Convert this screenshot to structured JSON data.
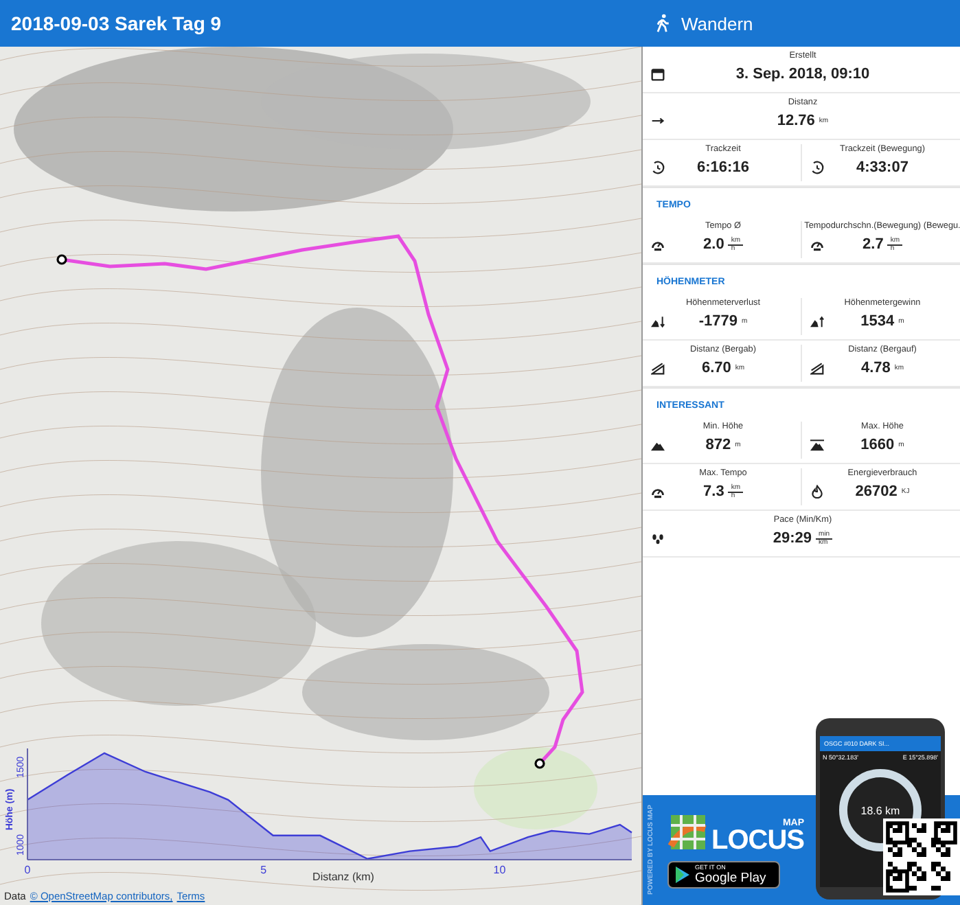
{
  "window": {
    "title": "2018-09-03 Sarek Tag 9"
  },
  "map": {
    "attribution": {
      "text": "Data",
      "links": [
        "© OpenStreetMap contributors,",
        "Terms"
      ]
    },
    "elevation_profile": {
      "chart_data": {
        "type": "area",
        "xlabel": "Distanz (km)",
        "ylabel": "Höhe (m)",
        "x": [
          0,
          0.85,
          1.63,
          2.5,
          3.86,
          4.25,
          5.2,
          6.2,
          7.2,
          8.1,
          9.1,
          9.6,
          9.8,
          10.6,
          11.1,
          11.9,
          12.55,
          12.8
        ],
        "series": [
          {
            "color": "#3d3dd6",
            "values": [
              1290,
              1450,
              1590,
              1470,
              1340,
              1290,
              1060,
              1060,
              910,
              960,
              990,
              1050,
              960,
              1050,
              1090,
              1070,
              1130,
              1080
            ]
          }
        ],
        "xlim": [
          0,
          12.8
        ],
        "ylim": [
          905,
          1620
        ],
        "xticks": [
          0,
          5,
          10
        ],
        "yticks": [
          1000,
          1500
        ]
      }
    }
  },
  "panel": {
    "title": "Wandern",
    "sections": [
      {
        "rows": [
          {
            "cells": [
              {
                "label": "Erstellt",
                "value": "3. Sep. 2018, 09:10"
              }
            ]
          },
          {
            "cells": [
              {
                "label": "Distanz",
                "value": "12.76",
                "unit": "km"
              }
            ]
          },
          {
            "cells": [
              {
                "label": "Trackzeit",
                "value": "6:16:16"
              },
              {
                "label": "Trackzeit (Bewegung)",
                "value": "4:33:07"
              }
            ]
          }
        ]
      },
      {
        "heading": "TEMPO",
        "rows": [
          {
            "cells": [
              {
                "label": "Tempo Ø",
                "value": "2.0",
                "unit_num": "km",
                "unit_den": "h"
              },
              {
                "label": "Tempodurchschn.(Bewegung) (Bewegu.",
                "value": "2.7",
                "unit_num": "km",
                "unit_den": "h"
              }
            ]
          }
        ]
      },
      {
        "heading": "HÖHENMETER",
        "rows": [
          {
            "cells": [
              {
                "label": "Höhenmeterverlust",
                "value": "-1779",
                "unit": "m"
              },
              {
                "label": "Höhenmetergewinn",
                "value": "1534",
                "unit": "m"
              }
            ]
          },
          {
            "cells": [
              {
                "label": "Distanz (Bergab)",
                "value": "6.70",
                "unit": "km"
              },
              {
                "label": "Distanz (Bergauf)",
                "value": "4.78",
                "unit": "km"
              }
            ]
          }
        ]
      },
      {
        "heading": "INTERESSANT",
        "rows": [
          {
            "cells": [
              {
                "label": "Min. Höhe",
                "value": "872",
                "unit": "m"
              },
              {
                "label": "Max. Höhe",
                "value": "1660",
                "unit": "m"
              }
            ]
          },
          {
            "cells": [
              {
                "label": "Max. Tempo",
                "value": "7.3",
                "unit_num": "km",
                "unit_den": "h"
              },
              {
                "label": "Energieverbrauch",
                "value": "26702",
                "unit": "KJ"
              }
            ]
          },
          {
            "cells": [
              {
                "label": "Pace (Min/Km)",
                "value": "29:29",
                "unit_num": "min",
                "unit_den": "km"
              }
            ]
          }
        ]
      }
    ]
  },
  "promo": {
    "side_text": "POWERED BY LOCUS MAP",
    "logo_small": "MAP",
    "logo_big": "LOCUS",
    "store_small": "GET IT ON",
    "store_big": "Google Play",
    "phone": {
      "title": "OSGC #010 DARK SI...",
      "lat": "N 50°32.183'",
      "lon": "E 15°25.898'",
      "distance": "18.6 km"
    }
  }
}
